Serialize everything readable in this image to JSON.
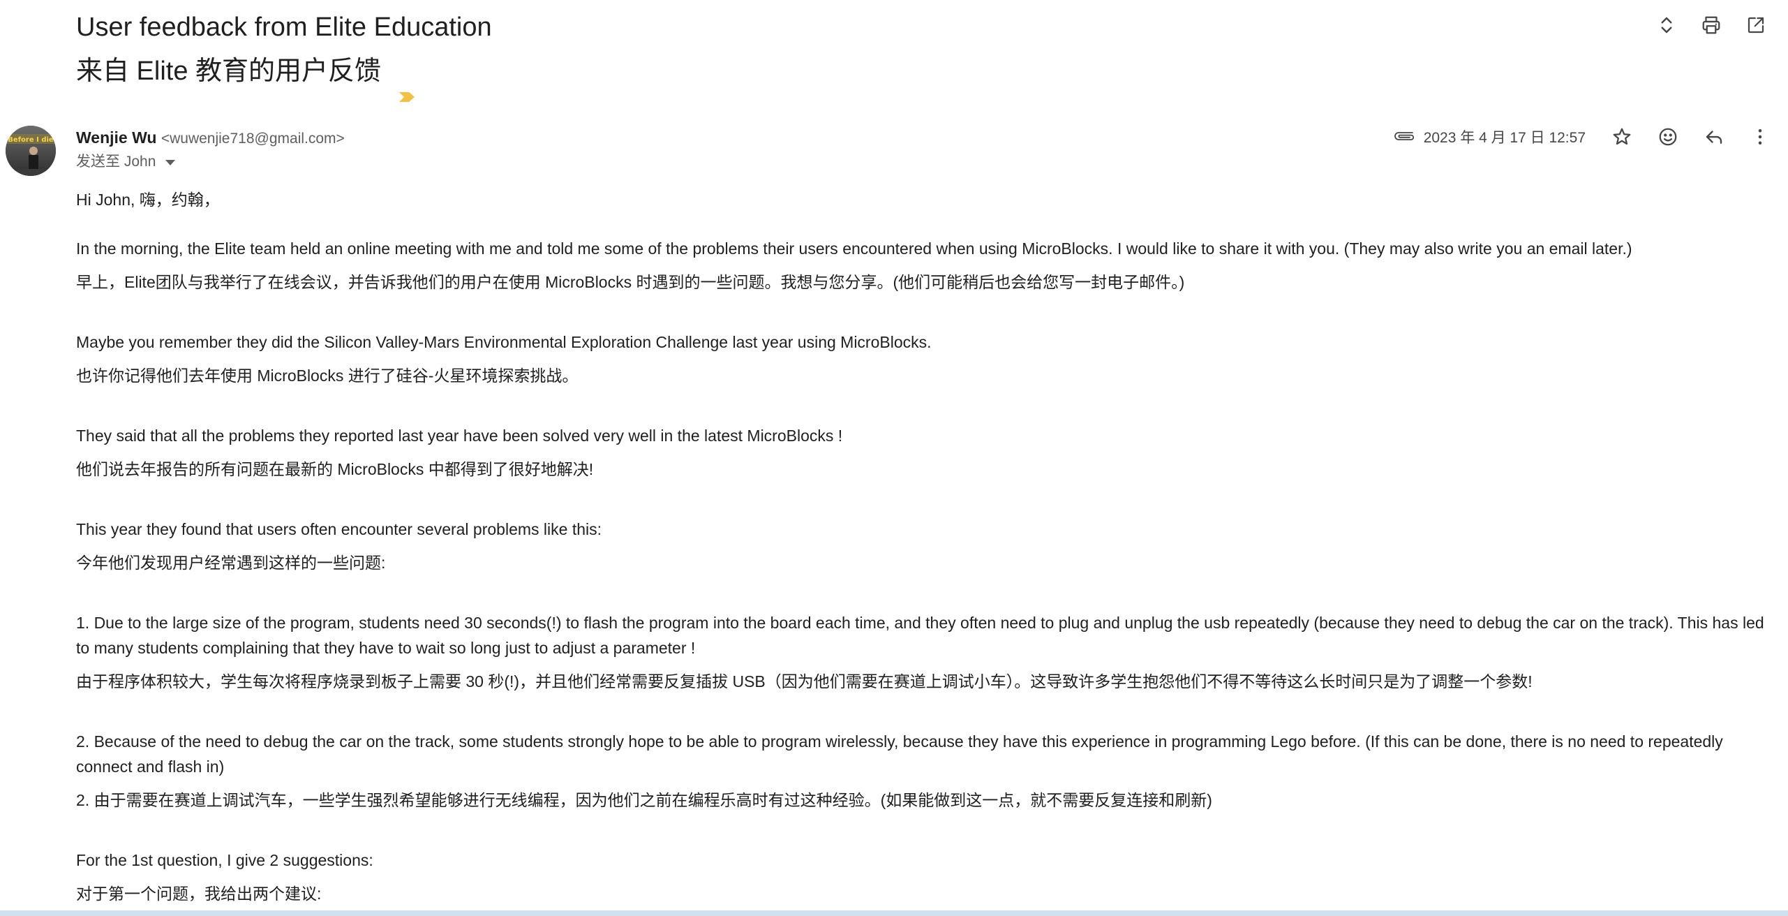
{
  "email": {
    "subject_en": "User feedback from Elite Education",
    "subject_zh": "来自 Elite 教育的用户反馈",
    "sender": {
      "name": "Wenjie Wu",
      "email": "<wuwenjie718@gmail.com>",
      "avatar_text": "Before I die"
    },
    "recipient": "发送至 John",
    "date": "2023 年 4 月 17 日 12:57"
  },
  "toolbar": {
    "icons": [
      "expand-collapse-icon",
      "print-icon",
      "open-in-new-window-icon"
    ]
  },
  "message_actions": {
    "icons": [
      "attachment-icon",
      "star-icon",
      "emoji-reaction-icon",
      "reply-icon",
      "more-options-icon"
    ]
  },
  "body": {
    "greeting": "Hi John, 嗨，约翰，",
    "paragraphs": [
      {
        "en": "In the morning, the Elite team held an online meeting with me and told me some of the problems their users encountered when using MicroBlocks. I would like to share it with you. (They may also write you an email later.)",
        "zh": "早上，Elite团队与我举行了在线会议，并告诉我他们的用户在使用 MicroBlocks 时遇到的一些问题。我想与您分享。(他们可能稍后也会给您写一封电子邮件。)"
      },
      {
        "en": "Maybe you remember they did the Silicon Valley-Mars Environmental Exploration Challenge last year using MicroBlocks.",
        "zh": "也许你记得他们去年使用 MicroBlocks 进行了硅谷-火星环境探索挑战。"
      },
      {
        "en": "They said that all the problems they reported last year have been solved very well in the latest MicroBlocks !",
        "zh": "他们说去年报告的所有问题在最新的 MicroBlocks 中都得到了很好地解决!"
      },
      {
        "en": "This year they found that users often encounter several problems like this:",
        "zh": "今年他们发现用户经常遇到这样的一些问题:"
      },
      {
        "en": "1. Due to the large size of the program, students need 30 seconds(!) to flash the program into the board each time, and they often need to plug and unplug the usb repeatedly (because they need to debug the car on the track). This has led to many students complaining that they have to wait so long just to adjust a parameter !",
        "zh": "由于程序体积较大，学生每次将程序烧录到板子上需要 30 秒(!)，并且他们经常需要反复插拔 USB（因为他们需要在赛道上调试小车）。这导致许多学生抱怨他们不得不等待这么长时间只是为了调整一个参数!"
      },
      {
        "en": "2. Because of the need to debug the car on the track, some students strongly hope to be able to program wirelessly, because they have this experience in programming Lego before. (If this can be done, there is no need to repeatedly connect and flash in)",
        "zh": "2. 由于需要在赛道上调试汽车，一些学生强烈希望能够进行无线编程，因为他们之前在编程乐高时有过这种经验。(如果能做到这一点，就不需要反复连接和刷新)"
      },
      {
        "en": "For the 1st question, I give 2 suggestions:",
        "zh": "对于第一个问题，我给出两个建议:"
      }
    ]
  },
  "colors": {
    "important_marker": "#f2c043",
    "text_primary": "#1f1f1f",
    "text_secondary": "#5e5e5e",
    "bottom_bar": "#cfe0ee"
  }
}
